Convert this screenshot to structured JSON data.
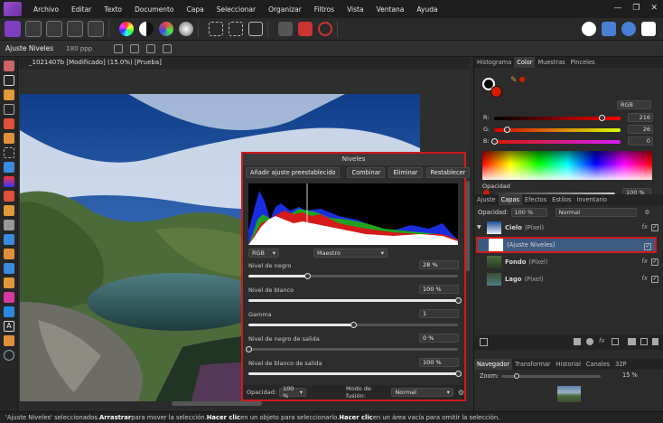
{
  "menubar": {
    "items": [
      "Archivo",
      "Editar",
      "Texto",
      "Documento",
      "Capa",
      "Seleccionar",
      "Organizar",
      "Filtros",
      "Vista",
      "Ventana",
      "Ayuda"
    ],
    "controls": [
      "—",
      "❐",
      "✕"
    ]
  },
  "context": {
    "title": "Ajuste Niveles",
    "dpi": "180 ppp"
  },
  "document": {
    "tab": "_1021407b [Modificado] (15.0%) [Prueba]"
  },
  "levels": {
    "title": "Niveles",
    "preset_button": "Añadir ajuste preestablecido",
    "buttons": [
      "Combinar",
      "Eliminar",
      "Restablecer"
    ],
    "channel_select": "RGB",
    "master_select": "Maestro",
    "rows": [
      {
        "label": "Nivel de negro",
        "value": "28 %",
        "level": 0.28
      },
      {
        "label": "Nivel de blanco",
        "value": "100 %",
        "level": 1.0
      },
      {
        "label": "Gamma",
        "value": "1",
        "level": 0.5
      },
      {
        "label": "Nivel de negro de salida",
        "value": "0 %",
        "level": 0.0
      },
      {
        "label": "Nivel de blanco de salida",
        "value": "100 %",
        "level": 1.0
      }
    ],
    "opacity_label": "Opacidad:",
    "opacity_value": "100 %",
    "blend_label": "Modo de fusión:",
    "blend_value": "Normal"
  },
  "color_panel": {
    "tabs": [
      "Histograma",
      "Color",
      "Muestras",
      "Pinceles"
    ],
    "active_tab": "Color",
    "mode": "RGB",
    "channels": [
      {
        "label": "R:",
        "value": "216",
        "level": 0.847
      },
      {
        "label": "G:",
        "value": "26",
        "level": 0.102
      },
      {
        "label": "B:",
        "value": "0",
        "level": 0.0
      }
    ],
    "opacity_label": "Opacidad",
    "opacity_value": "100 %",
    "fg_color": "#d81a00"
  },
  "layers_panel": {
    "tabs": [
      "Ajuste",
      "Capas",
      "Efectos",
      "Estilos",
      "Inventario"
    ],
    "active_tab": "Capas",
    "opacity_label": "Opacidad:",
    "opacity_value": "100 %",
    "blend_value": "Normal",
    "layers": [
      {
        "name": "Cielo",
        "type": "(Píxel)"
      },
      {
        "name": "(Ajuste Niveles)",
        "type": ""
      },
      {
        "name": "Fondo",
        "type": "(Píxel)"
      },
      {
        "name": "Lago",
        "type": "(Píxel)"
      }
    ]
  },
  "navigator_panel": {
    "tabs": [
      "Navegador",
      "Transformar",
      "Historial",
      "Canales",
      "32P"
    ],
    "active_tab": "Navegador",
    "zoom_label": "Zoom:",
    "zoom_value": "15 %"
  },
  "status": {
    "parts": [
      {
        "text": "'Ajuste Niveles' seleccionados. ",
        "bold": false
      },
      {
        "text": "Arrastrar",
        "bold": true
      },
      {
        "text": " para mover la selección. ",
        "bold": false
      },
      {
        "text": "Hacer clic",
        "bold": true
      },
      {
        "text": " en un objeto para seleccionarlo. ",
        "bold": false
      },
      {
        "text": "Hacer clic",
        "bold": true
      },
      {
        "text": " en un área vacía para omitir la selección.",
        "bold": false
      }
    ]
  }
}
